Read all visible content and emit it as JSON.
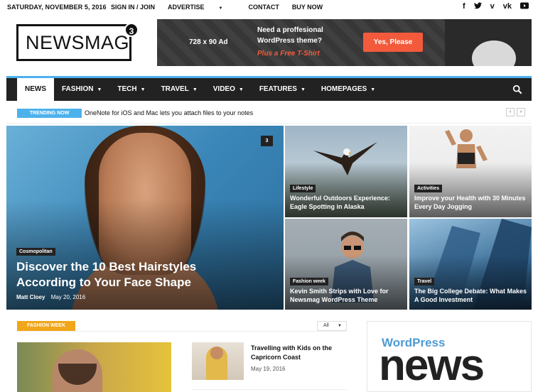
{
  "topbar": {
    "date": "SATURDAY, NOVEMBER 5, 2016",
    "links": [
      "SIGN IN / JOIN",
      "ADVERTISE",
      "CONTACT",
      "BUY NOW"
    ],
    "social_icons": [
      "facebook-icon",
      "twitter-icon",
      "vimeo-icon",
      "vk-icon",
      "youtube-icon"
    ]
  },
  "logo": {
    "text": "NEWSMAG",
    "badge": "3"
  },
  "ad": {
    "size": "728 x 90 Ad",
    "line1": "Need a proffesional",
    "line2": "WordPress theme?",
    "line3": "Plus a Free T-Shirt",
    "button": "Yes, Please",
    "accent": "#f35a3c"
  },
  "nav": {
    "items": [
      "NEWS",
      "FASHION",
      "TECH",
      "TRAVEL",
      "VIDEO",
      "FEATURES",
      "HOMEPAGES"
    ],
    "accent": "#4db2ec"
  },
  "trending": {
    "label": "TRENDING NOW",
    "text": "OneNote for iOS and Mac lets you attach files to your notes"
  },
  "featured": {
    "main": {
      "category": "Cosmopolitan",
      "title": "Discover the 10 Best Hairstyles According to Your Face Shape",
      "author": "Matt Cloey",
      "date": "May 20, 2016",
      "comments": "3"
    },
    "tiles": [
      {
        "category": "Lifestyle",
        "title": "Wonderful Outdoors Experience: Eagle Spotting in Alaska"
      },
      {
        "category": "Activities",
        "title": "Improve your Health with 30 Minutes Every Day Jogging"
      },
      {
        "category": "Fashion week",
        "title": "Kevin Smith Strips with Love for Newsmag WordPress Theme"
      },
      {
        "category": "Travel",
        "title": "The Big College Debate: What Makes A Good Investment"
      }
    ]
  },
  "section": {
    "label": "FASHION WEEK",
    "filter": "All",
    "accent": "#f0a61a",
    "small_post": {
      "title": "Travelling with Kids on the Capricorn Coast",
      "date": "May 19, 2016"
    }
  },
  "sidebar_ad": {
    "word": "WordPress",
    "big": "news"
  }
}
